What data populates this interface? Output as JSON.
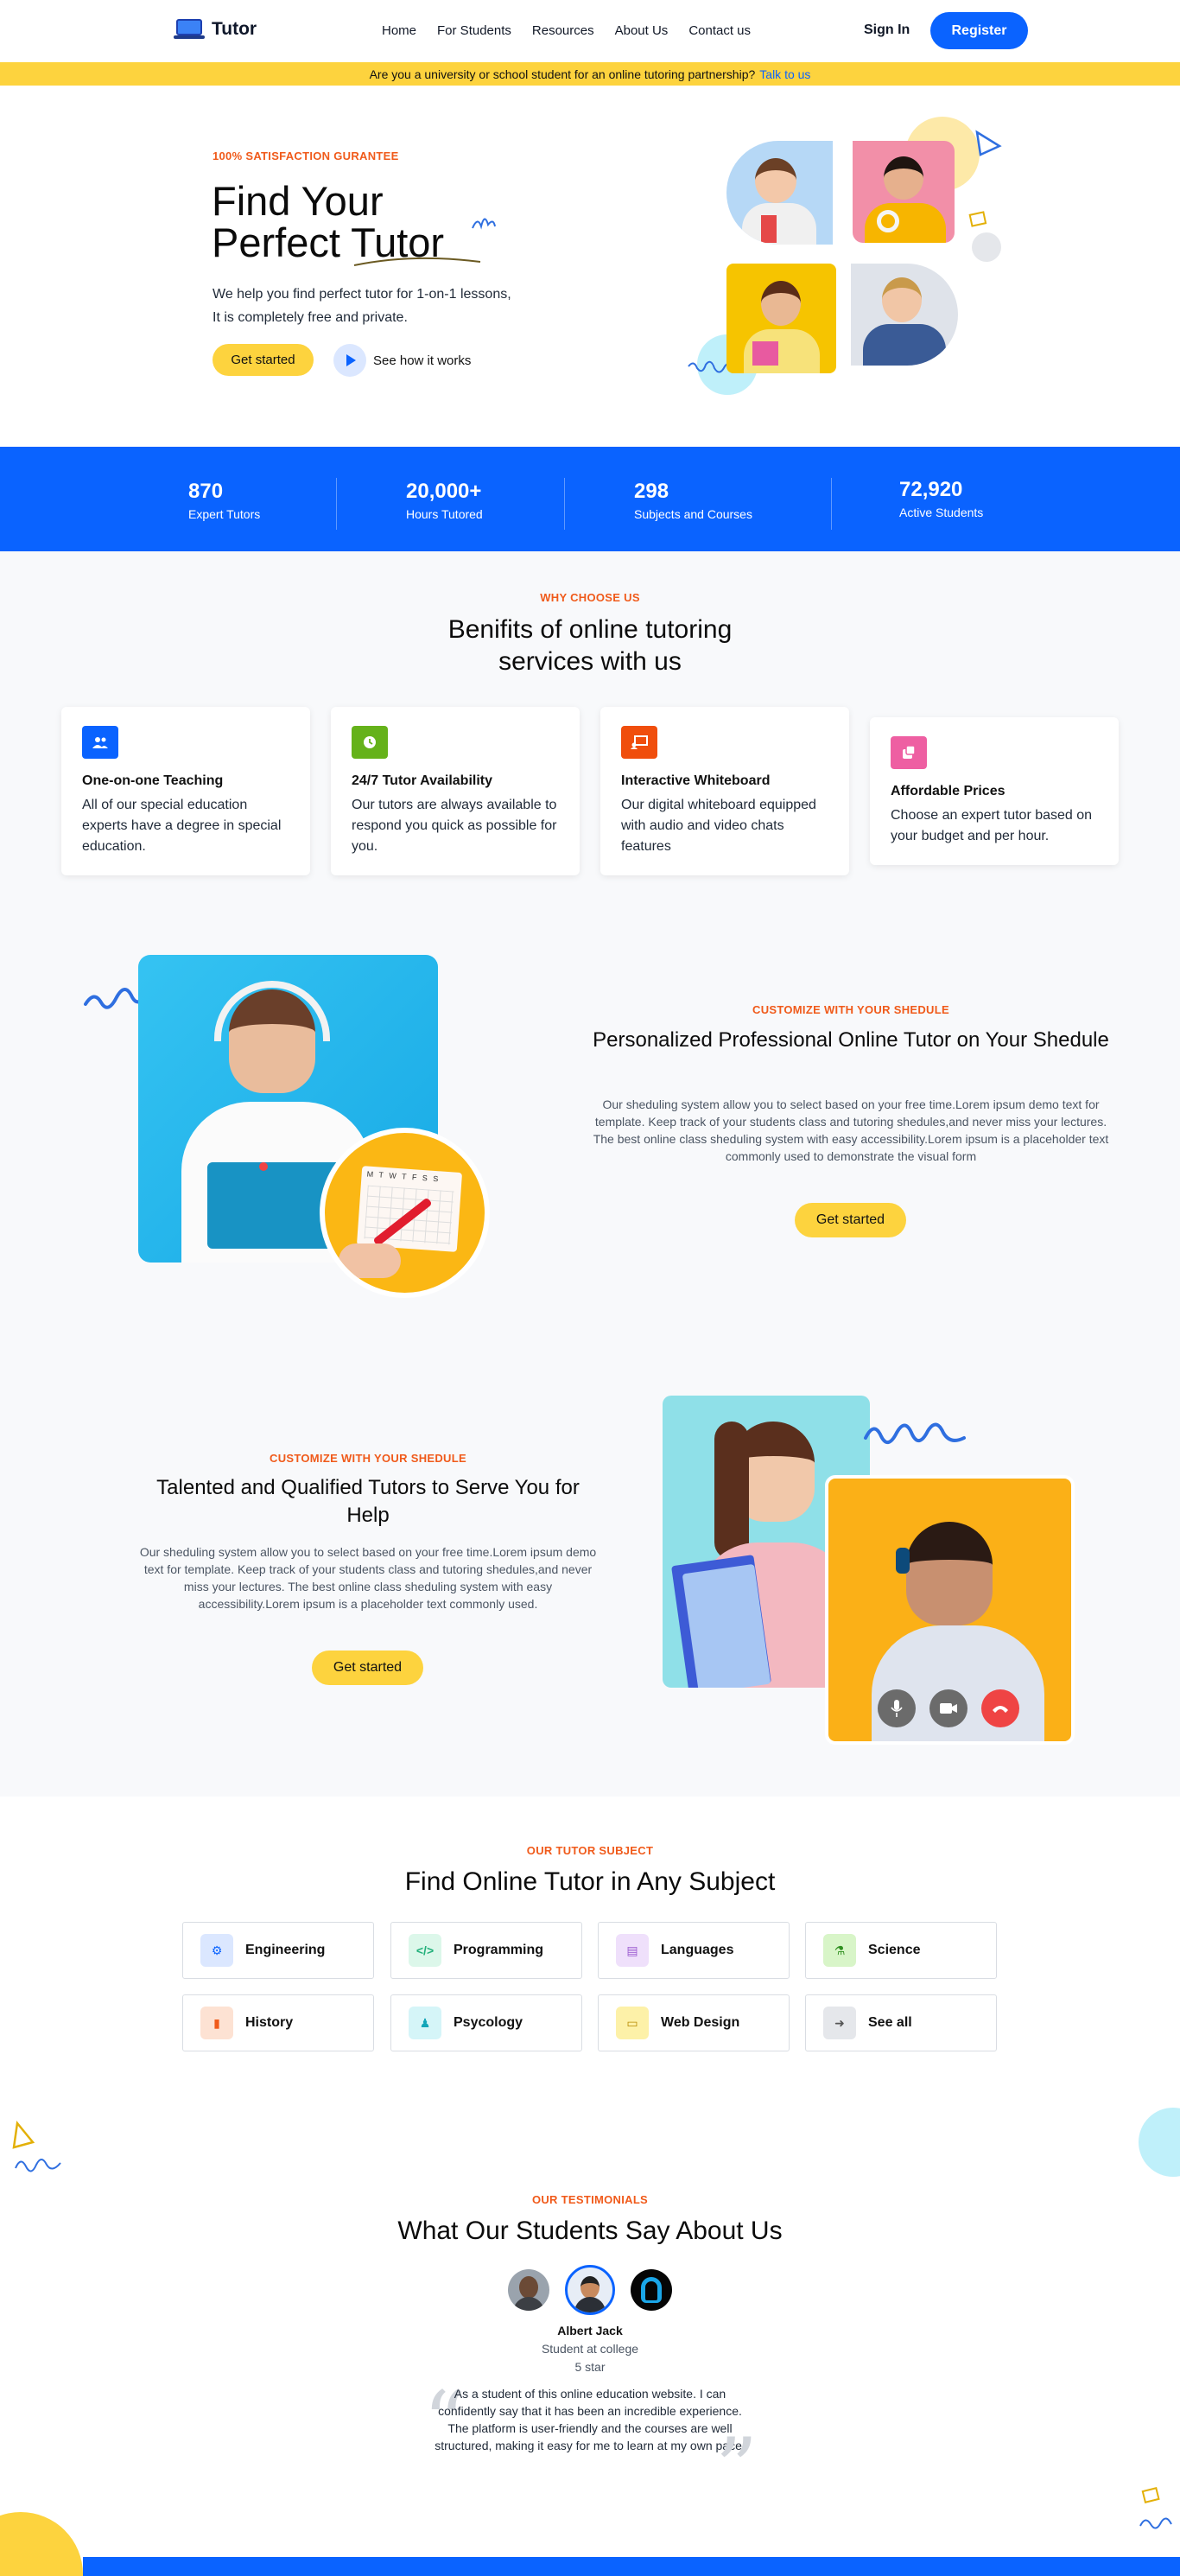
{
  "nav": {
    "brand": "Tutor",
    "menu": [
      "Home",
      "For Students",
      "Resources",
      "About Us",
      "Contact us"
    ],
    "sign_in": "Sign In",
    "register": "Register"
  },
  "banner": {
    "text": "Are you a university or school student for an online tutoring partnership?",
    "link": "Talk to us"
  },
  "hero": {
    "eyebrow": "100% SATISFACTION GURANTEE",
    "title_line1": "Find Your",
    "title_line2": "Perfect Tutor",
    "desc_line1": "We help you find perfect tutor for 1-on-1 lessons,",
    "desc_line2": "It is completely free and private.",
    "cta": "Get started",
    "play": "See how it works"
  },
  "stats": [
    {
      "num": "870",
      "label": "Expert Tutors"
    },
    {
      "num": "20,000+",
      "label": "Hours Tutored"
    },
    {
      "num": "298",
      "label": "Subjects and Courses"
    },
    {
      "num": "72,920",
      "label": "Active Students"
    }
  ],
  "benefits": {
    "eyebrow": "WHY CHOOSE US",
    "title_line1": "Benifits of online tutoring",
    "title_line2": "services with us",
    "cards": [
      {
        "title": "One-on-one Teaching",
        "desc": "All of our special education experts have a degree in special education.",
        "color": "#0a63ff",
        "icon": "users-icon"
      },
      {
        "title": "24/7 Tutor Availability",
        "desc": "Our tutors are always available to respond you quick as possible for you.",
        "color": "#65b21a",
        "icon": "clock-icon"
      },
      {
        "title": "Interactive Whiteboard",
        "desc": "Our digital whiteboard equipped with audio and video chats features",
        "color": "#f04e0c",
        "icon": "whiteboard-icon"
      },
      {
        "title": "Affordable Prices",
        "desc": "Choose an expert tutor based on your budget and per hour.",
        "color": "#ee5fa2",
        "icon": "price-tag-icon"
      }
    ]
  },
  "schedule": {
    "eyebrow": "CUSTOMIZE WITH YOUR SHEDULE",
    "title": "Personalized Professional Online Tutor on Your Shedule",
    "desc": "Our sheduling system allow you to select based on your free time.Lorem ipsum demo text for template. Keep track of your students class and tutoring shedules,and never miss your lectures. The best online class sheduling system with easy accessibility.Lorem ipsum is a placeholder text commonly used to demonstrate the visual form",
    "cta": "Get started",
    "calendar_days": "M T W T F S S"
  },
  "tutors": {
    "eyebrow": "CUSTOMIZE WITH YOUR SHEDULE",
    "title": "Talented and Qualified Tutors to Serve You for Help",
    "desc": "Our sheduling system allow you to select based on your free time.Lorem ipsum demo text for template. Keep track of your students class and tutoring shedules,and never miss your lectures. The best online class sheduling system with easy accessibility.Lorem ipsum is a placeholder text commonly used.",
    "cta": "Get started"
  },
  "subjects": {
    "eyebrow": "OUR TUTOR SUBJECT",
    "title": "Find Online Tutor in Any Subject",
    "items": [
      {
        "label": "Engineering",
        "bg": "#dbe7ff",
        "fg": "#0a63ff",
        "icon": "gear-icon"
      },
      {
        "label": "Programming",
        "bg": "#dcf7ea",
        "fg": "#22b07a",
        "icon": "code-icon"
      },
      {
        "label": "Languages",
        "bg": "#efe0fb",
        "fg": "#9b59d0",
        "icon": "language-icon"
      },
      {
        "label": "Science",
        "bg": "#d8f5c8",
        "fg": "#2f8f1f",
        "icon": "flask-icon"
      },
      {
        "label": "History",
        "bg": "#fde2d3",
        "fg": "#f05a1a",
        "icon": "book-icon"
      },
      {
        "label": "Psycology",
        "bg": "#d5f5f8",
        "fg": "#12a5b8",
        "icon": "person-icon"
      },
      {
        "label": "Web Design",
        "bg": "#fdf1a8",
        "fg": "#b88a00",
        "icon": "monitor-icon"
      },
      {
        "label": "See all",
        "bg": "#e5e7eb",
        "fg": "#555",
        "icon": "arrow-right-icon"
      }
    ]
  },
  "testimonials": {
    "eyebrow": "OUR TESTIMONIALS",
    "title": "What Our Students Say About Us",
    "name": "Albert Jack",
    "role": "Student at college",
    "rating": "5 star",
    "quote": "As a student of this online education website. I can confidently say that it has been an incredible experience. The platform is user-friendly and the courses are well structured, making it easy for me to learn at my own pace."
  }
}
